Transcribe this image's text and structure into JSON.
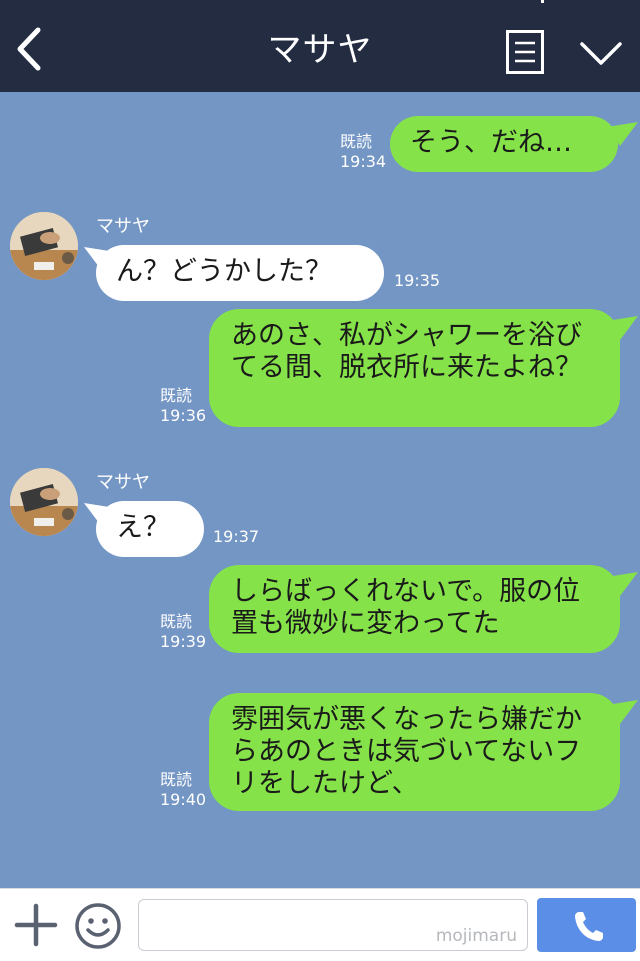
{
  "header": {
    "title": "マサヤ",
    "back_icon": "chevron-left-icon",
    "menu_icon": "list-icon",
    "collapse_icon": "chevron-down-icon"
  },
  "messages": [
    {
      "side": "mine",
      "text": "そう、だね…",
      "read": "既読",
      "time": "19:34"
    },
    {
      "side": "theirs",
      "sender": "マサヤ",
      "text": "ん？どうかした？",
      "time": "19:35"
    },
    {
      "side": "mine",
      "text": "あのさ、私がシャワーを浴びてる間、脱衣所に来たよね？",
      "read": "既読",
      "time": "19:36"
    },
    {
      "side": "theirs",
      "sender": "マサヤ",
      "text": "え？",
      "time": "19:37"
    },
    {
      "side": "mine",
      "text": "しらばっくれないで。服の位置も微妙に変わってた",
      "read": "既読",
      "time": "19:39"
    },
    {
      "side": "mine",
      "text": "雰囲気が悪くなったら嫌だからあのときは気づいてないフリをしたけど、",
      "read": "既読",
      "time": "19:40"
    }
  ],
  "footer": {
    "watermark": "mojimaru",
    "plus_icon": "plus-icon",
    "emoji_icon": "smiley-icon",
    "call_icon": "phone-icon"
  },
  "colors": {
    "header_bg": "#232c41",
    "chat_bg": "#7496c4",
    "my_bubble": "#85e249",
    "their_bubble": "#ffffff",
    "call_button": "#5b8ee6"
  }
}
